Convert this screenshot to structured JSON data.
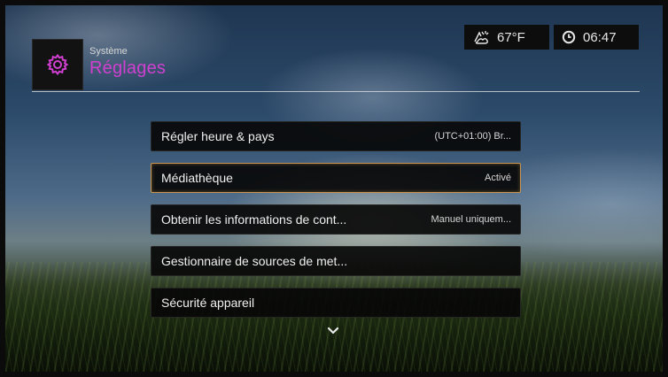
{
  "header": {
    "breadcrumb": "Système",
    "title": "Réglages",
    "icon": "gear-icon",
    "accent_color": "#d040d0"
  },
  "status_bar": {
    "weather": {
      "icon": "weather-icon",
      "temperature": "67°F"
    },
    "clock": {
      "icon": "clock-icon",
      "time": "06:47"
    }
  },
  "menu": {
    "items": [
      {
        "label": "Régler heure & pays",
        "value": "(UTC+01:00) Br..."
      },
      {
        "label": "Médiathèque",
        "value": "Activé",
        "selected": true
      },
      {
        "label": "Obtenir les informations de cont...",
        "value": "Manuel uniquem..."
      },
      {
        "label": "Gestionnaire de sources de met...",
        "value": ""
      },
      {
        "label": "Sécurité appareil",
        "value": ""
      }
    ],
    "more_indicator": "chevron-down-icon"
  },
  "colors": {
    "selection_border": "#c89650"
  }
}
